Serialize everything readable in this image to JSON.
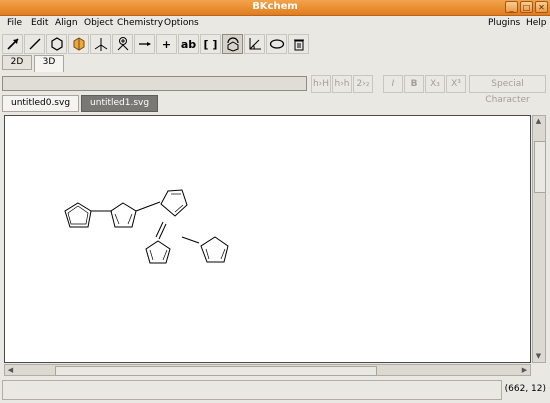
{
  "window": {
    "title": "BKchem"
  },
  "menu": {
    "left": [
      {
        "label": "File"
      },
      {
        "label": "Edit"
      },
      {
        "label": "Align"
      },
      {
        "label": "Object"
      },
      {
        "label": "Chemistry"
      },
      {
        "label": "Options"
      }
    ],
    "right": [
      {
        "label": "Plugins"
      },
      {
        "label": "Help"
      }
    ]
  },
  "toolbar": {
    "tools": [
      {
        "name": "arrow-tool-icon"
      },
      {
        "name": "bond-tool-icon"
      },
      {
        "name": "ring-tool-icon"
      },
      {
        "name": "vector-tool-icon"
      },
      {
        "name": "template-tool-icon"
      },
      {
        "name": "charge-tool-icon"
      },
      {
        "name": "reaction-arrow-icon"
      },
      {
        "name": "plus-tool-icon",
        "label": "+"
      },
      {
        "name": "text-tool-icon",
        "label": "ab"
      },
      {
        "name": "bracket-tool-icon",
        "label": "[ ]"
      },
      {
        "name": "rotate-tool-icon"
      },
      {
        "name": "angle-tool-icon"
      },
      {
        "name": "oval-tool-icon"
      },
      {
        "name": "delete-tool-icon"
      }
    ]
  },
  "modes": [
    {
      "label": "2D"
    },
    {
      "label": "3D"
    }
  ],
  "edit_buttons": [
    {
      "label": "h›H"
    },
    {
      "label": "h›h"
    },
    {
      "label": "2›₂"
    },
    {
      "label": "I"
    },
    {
      "label": "B"
    },
    {
      "label": "X₃"
    },
    {
      "label": "X³"
    },
    {
      "label": "Special Character"
    }
  ],
  "tabs": [
    {
      "label": "untitled0.svg"
    },
    {
      "label": "untitled1.svg"
    }
  ],
  "status": {
    "coords": "(662, 12)"
  }
}
